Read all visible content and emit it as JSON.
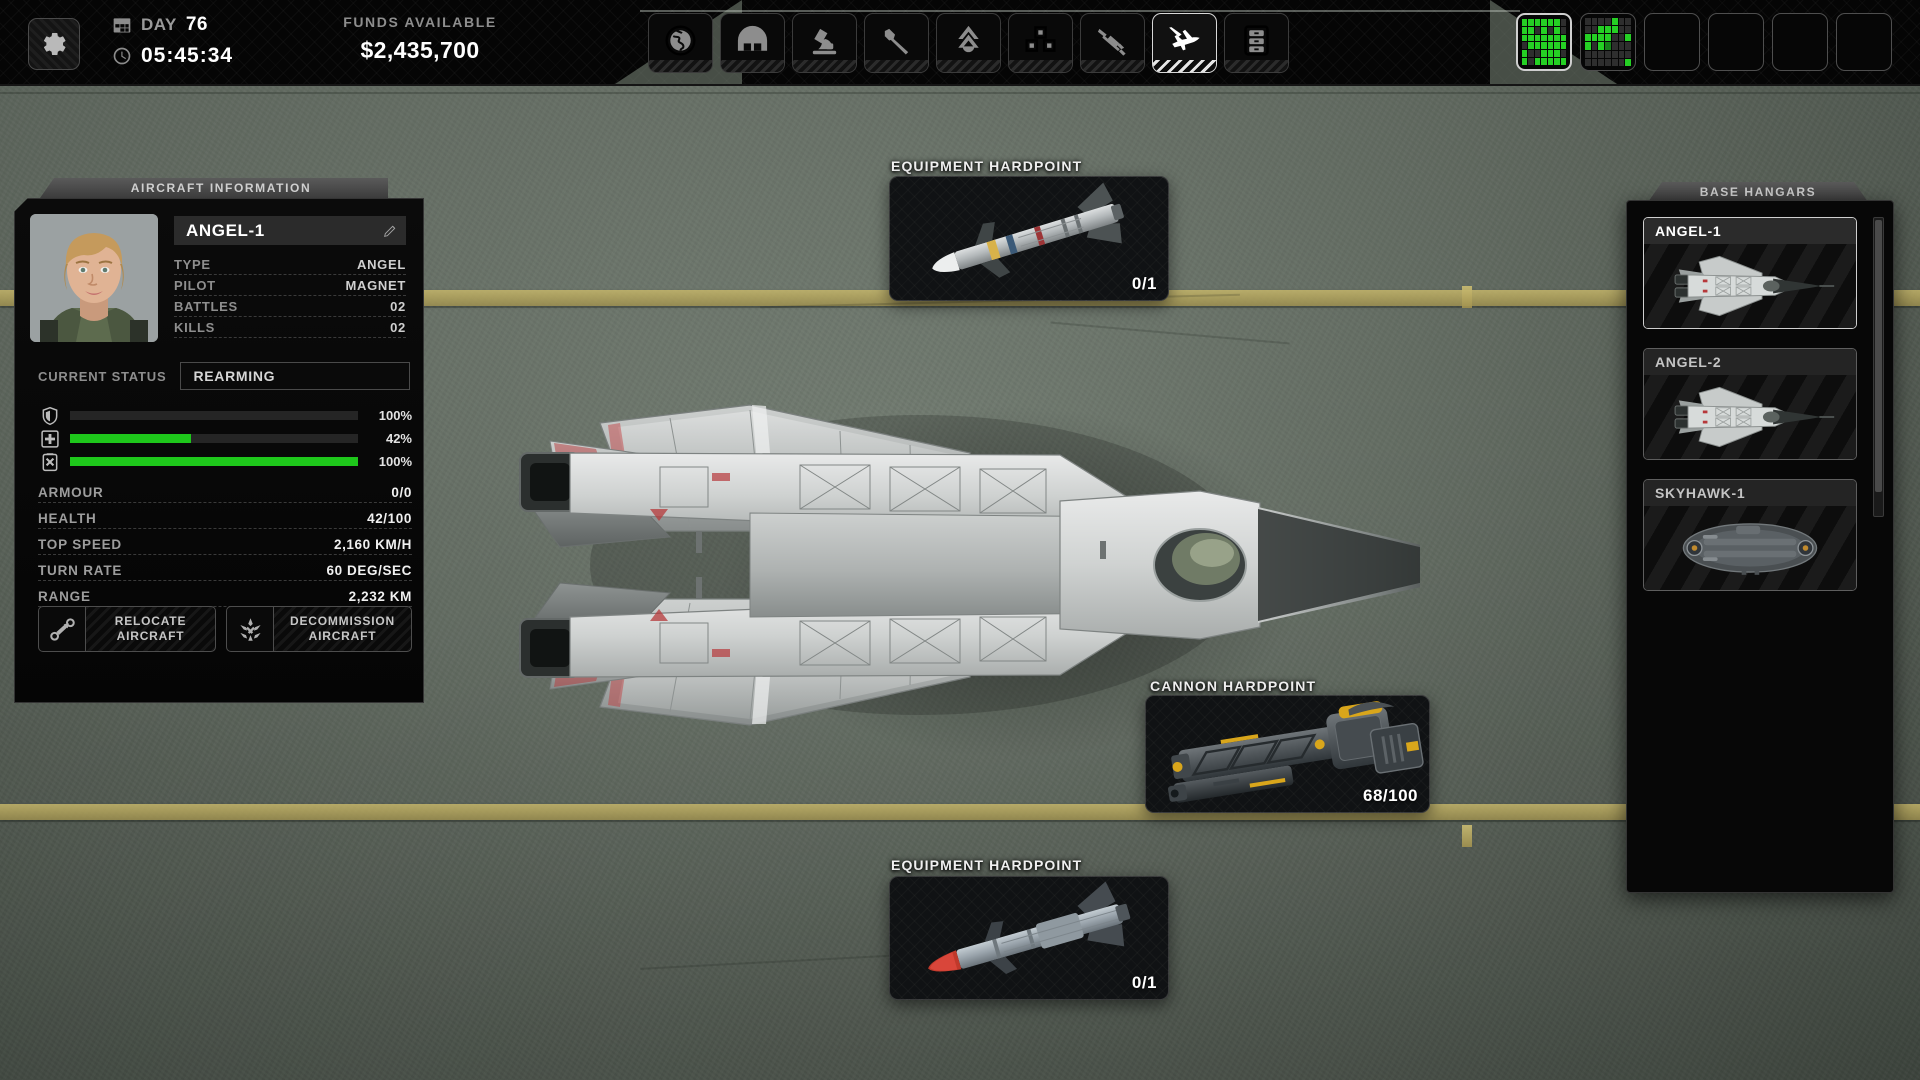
{
  "topbar": {
    "settings_icon": "gear-icon",
    "day_label": "DAY",
    "day_value": "76",
    "calendar_icon": "calendar-icon",
    "clock_icon": "clock-icon",
    "clock_value": "05:45:34",
    "funds_label": "FUNDS AVAILABLE",
    "funds_value": "$2,435,700",
    "nav": [
      {
        "name": "geoscape",
        "icon": "globe-icon",
        "active": false
      },
      {
        "name": "base",
        "icon": "hangar-icon",
        "active": false
      },
      {
        "name": "research",
        "icon": "microscope-icon",
        "active": false
      },
      {
        "name": "engineering",
        "icon": "wrench-icon",
        "active": false
      },
      {
        "name": "soldiers",
        "icon": "rank-chevron-icon",
        "active": false
      },
      {
        "name": "stores",
        "icon": "crates-icon",
        "active": false
      },
      {
        "name": "armoury",
        "icon": "rifle-icon",
        "active": false
      },
      {
        "name": "aircraft",
        "icon": "jet-icon",
        "active": true
      },
      {
        "name": "archive",
        "icon": "file-cabinet-icon",
        "active": false
      }
    ],
    "slots": [
      {
        "name": "mission-slot-1",
        "selected": true,
        "cells": "1111110110101011111110111111100111010"
      },
      {
        "name": "mission-slot-2",
        "selected": false,
        "cells": "0000100001110011110011010000000000000"
      },
      {
        "name": "mission-slot-3",
        "selected": false,
        "cells": ""
      },
      {
        "name": "mission-slot-4",
        "selected": false,
        "cells": ""
      },
      {
        "name": "mission-slot-5",
        "selected": false,
        "cells": ""
      },
      {
        "name": "mission-slot-6",
        "selected": false,
        "cells": ""
      }
    ]
  },
  "aircraft_info": {
    "panel_title": "AIRCRAFT INFORMATION",
    "portrait_alt": "pilot-portrait",
    "name": "ANGEL-1",
    "edit_icon": "pencil-icon",
    "fields": [
      {
        "key": "TYPE",
        "value": "ANGEL"
      },
      {
        "key": "PILOT",
        "value": "MAGNET"
      },
      {
        "key": "BATTLES",
        "value": "02"
      },
      {
        "key": "KILLS",
        "value": "02"
      }
    ],
    "status_label": "CURRENT STATUS",
    "status_value": "REARMING",
    "bars": [
      {
        "icon": "shield-icon",
        "name": "armour-bar",
        "pct": 100,
        "display": "100%",
        "empty": true
      },
      {
        "icon": "medkit-icon",
        "name": "health-bar",
        "pct": 42,
        "display": "42%",
        "empty": false
      },
      {
        "icon": "fuel-icon",
        "name": "fuel-bar",
        "pct": 100,
        "display": "100%",
        "empty": false
      }
    ],
    "stats": [
      {
        "key": "ARMOUR",
        "value": "0/0"
      },
      {
        "key": "HEALTH",
        "value": "42/100"
      },
      {
        "key": "TOP SPEED",
        "value": "2,160 KM/H"
      },
      {
        "key": "TURN RATE",
        "value": "60 DEG/SEC"
      },
      {
        "key": "RANGE",
        "value": "2,232 KM"
      }
    ],
    "buttons": [
      {
        "name": "relocate-aircraft-button",
        "icon": "relocate-icon",
        "line1": "RELOCATE",
        "line2": "AIRCRAFT"
      },
      {
        "name": "decommission-aircraft-button",
        "icon": "decommission-icon",
        "line1": "DECOMMISSION",
        "line2": "AIRCRAFT"
      }
    ]
  },
  "hardpoints": [
    {
      "name": "equipment-hardpoint-top",
      "label": "EQUIPMENT HARDPOINT",
      "count": "0/1",
      "art": "missile-agm"
    },
    {
      "name": "cannon-hardpoint",
      "label": "CANNON HARDPOINT",
      "count": "68/100",
      "art": "cannon"
    },
    {
      "name": "equipment-hardpoint-bottom",
      "label": "EQUIPMENT HARDPOINT",
      "count": "0/1",
      "art": "missile-aam"
    }
  ],
  "hangars": {
    "panel_title": "BASE HANGARS",
    "items": [
      {
        "name": "hangar-card-angel-1",
        "label": "ANGEL-1",
        "selected": true,
        "art": "jet"
      },
      {
        "name": "hangar-card-angel-2",
        "label": "ANGEL-2",
        "selected": false,
        "art": "jet"
      },
      {
        "name": "hangar-card-skyhawk-1",
        "label": "SKYHAWK-1",
        "selected": false,
        "art": "dropship"
      }
    ]
  },
  "colors": {
    "accent_green": "#1ec71b",
    "panel_bg": "#070707",
    "tab_grey": "#4a4a4a",
    "tarmac": "#6e786d",
    "runway_line": "#b7a75d"
  }
}
